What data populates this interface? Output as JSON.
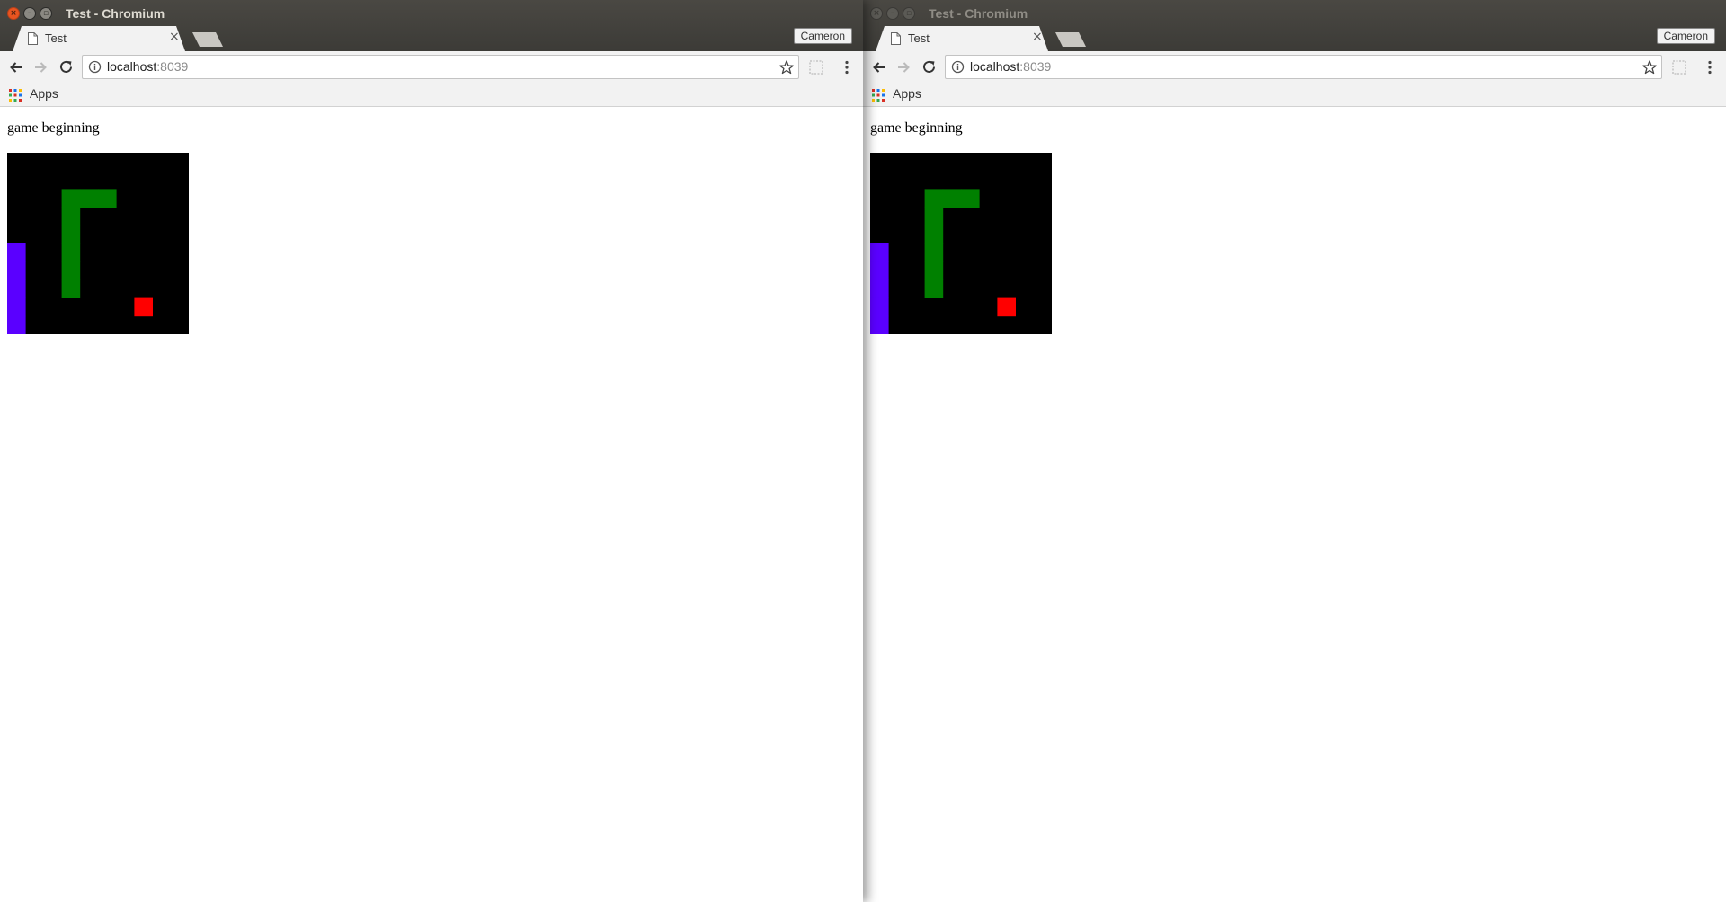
{
  "windows": [
    {
      "id": "left",
      "state": "active",
      "title": "Test - Chromium",
      "tab_label": "Test",
      "tab_close": "×",
      "profile": "Cameron",
      "url_host": "localhost",
      "url_port": ":8039",
      "bookmark_apps": "Apps",
      "status_text": "game beginning"
    },
    {
      "id": "right",
      "state": "inactive",
      "title": "Test - Chromium",
      "tab_label": "Test",
      "tab_close": "×",
      "profile": "Cameron",
      "url_host": "localhost",
      "url_port": ":8039",
      "bookmark_apps": "Apps",
      "status_text": "game beginning"
    }
  ],
  "icons": {
    "back": "back-arrow-icon",
    "forward": "forward-arrow-icon",
    "reload": "reload-icon",
    "info": "info-icon",
    "star": "bookmark-star-icon",
    "extension": "extension-icon",
    "menu": "menu-dots-icon",
    "apps": "apps-grid-icon",
    "page": "page-icon"
  },
  "game": {
    "grid": {
      "cols": 10,
      "rows": 10
    },
    "colors": {
      "background": "#000000",
      "snake": "#008000",
      "paddle": "#5a00ff",
      "food": "#ff0000"
    },
    "snake_cells": [
      [
        3,
        2
      ],
      [
        4,
        2
      ],
      [
        5,
        2
      ],
      [
        3,
        3
      ],
      [
        3,
        4
      ],
      [
        3,
        5
      ],
      [
        3,
        6
      ],
      [
        3,
        7
      ]
    ],
    "paddle_cells": [
      [
        0,
        5
      ],
      [
        0,
        6
      ],
      [
        0,
        7
      ],
      [
        0,
        8
      ],
      [
        0,
        9
      ]
    ],
    "food_cell": [
      7,
      8
    ]
  },
  "theme": {
    "titlebar": "#3c3b37",
    "close_button": "#e95420",
    "toolbar": "#f2f2f2"
  }
}
